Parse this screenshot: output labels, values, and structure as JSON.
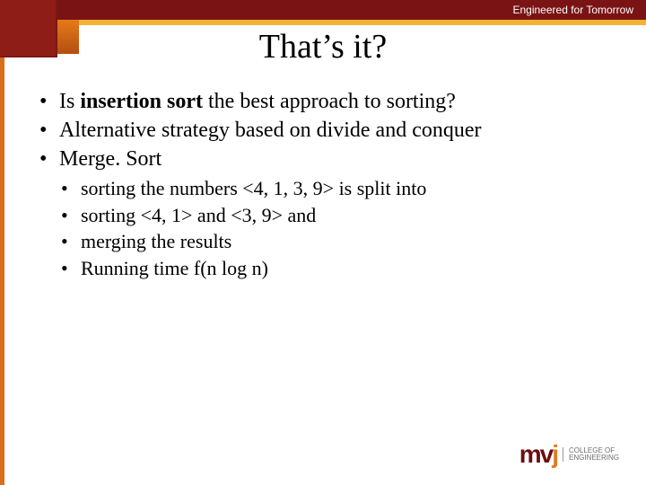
{
  "brand": {
    "tagline": "Engineered for Tomorrow",
    "logo_mark_left": "m",
    "logo_mark_mid": "v",
    "logo_mark_right": "j",
    "logo_text_top": "COLLEGE OF",
    "logo_text_bot": "ENGINEERING"
  },
  "title": "That’s it?",
  "bullets": {
    "b1_pre": "Is ",
    "b1_bold": "insertion sort",
    "b1_post": " the best approach to sorting?",
    "b2": "Alternative strategy based on divide and conquer",
    "b3": "Merge. Sort",
    "sub1": "sorting the numbers <4, 1, 3, 9> is split into",
    "sub2": "sorting <4, 1> and <3, 9> and",
    "sub3": "merging the results",
    "sub4": "Running time f(n log n)"
  }
}
